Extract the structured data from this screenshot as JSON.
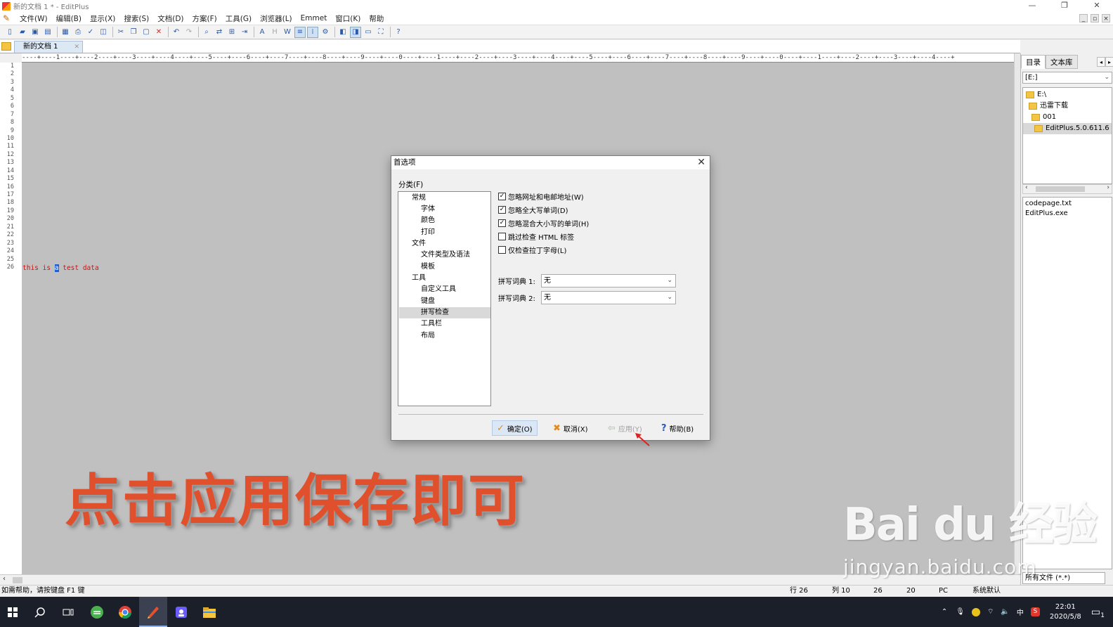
{
  "window": {
    "title": "新的文档 1 * - EditPlus",
    "controls": {
      "minimize": "—",
      "restore": "❐",
      "close": "✕"
    }
  },
  "menu": {
    "items": [
      "文件(W)",
      "编辑(B)",
      "显示(X)",
      "搜索(S)",
      "文档(D)",
      "方案(F)",
      "工具(G)",
      "浏览器(L)",
      "Emmet",
      "窗口(K)",
      "帮助"
    ],
    "mdi_controls": [
      "_",
      "▫",
      "×"
    ]
  },
  "tabs": {
    "document_tab": "新的文档 1"
  },
  "ruler": {
    "text": "----+----1----+----2----+----3----+----4----+----5----+----6----+----7----+----8----+----9----+----0----+----1----+----2----+----3----+----4----+----5----+----6----+----7----+----8----+----9----+----0----+----1----+----2----+----3----+----4----+"
  },
  "editor": {
    "line_numbers": [
      "1",
      "2",
      "3",
      "4",
      "5",
      "6",
      "7",
      "8",
      "9",
      "10",
      "11",
      "12",
      "13",
      "14",
      "15",
      "16",
      "17",
      "18",
      "19",
      "20",
      "21",
      "22",
      "23",
      "24",
      "25",
      "26"
    ],
    "line26_before": "this is ",
    "line26_selected": "a",
    "line26_after": " test data"
  },
  "caption": {
    "text": "点击应用保存即可",
    "color": "#e1502c"
  },
  "watermark": {
    "main": "Bai du 经验",
    "url": "jingyan.baidu.com"
  },
  "statusbar": {
    "help": "如需帮助，请按键盘 F1 键",
    "line": "行 26",
    "col": "列 10",
    "val1": "26",
    "val2": "20",
    "mode": "PC",
    "encoding": "系统默认"
  },
  "sidepanel": {
    "tabs": [
      "目录",
      "文本库"
    ],
    "drive": "[E:]",
    "tree": [
      "E:\\",
      "迅雷下载",
      "001",
      "EditPlus.5.0.611.6"
    ],
    "files": [
      "codepage.txt",
      "EditPlus.exe"
    ],
    "filter": "所有文件 (*.*)"
  },
  "dialog": {
    "title": "首选项",
    "category_label": "分类(F)",
    "categories": [
      {
        "label": "常规",
        "level": 0
      },
      {
        "label": "字体",
        "level": 1
      },
      {
        "label": "颜色",
        "level": 1
      },
      {
        "label": "打印",
        "level": 1
      },
      {
        "label": "文件",
        "level": 0
      },
      {
        "label": "文件类型及语法",
        "level": 1
      },
      {
        "label": "模板",
        "level": 1
      },
      {
        "label": "工具",
        "level": 0
      },
      {
        "label": "自定义工具",
        "level": 1
      },
      {
        "label": "键盘",
        "level": 1
      },
      {
        "label": "拼写检查",
        "level": 1,
        "selected": true
      },
      {
        "label": "工具栏",
        "level": 1
      },
      {
        "label": "布局",
        "level": 1
      }
    ],
    "checkboxes": [
      {
        "label": "忽略网址和电邮地址(W)",
        "checked": true
      },
      {
        "label": "忽略全大写单词(D)",
        "checked": true
      },
      {
        "label": "忽略混合大小写的单词(H)",
        "checked": true
      },
      {
        "label": "跳过检查 HTML 标签",
        "checked": false
      },
      {
        "label": "仅检查拉丁字母(L)",
        "checked": false
      }
    ],
    "dict1_label": "拼写词典 1:",
    "dict1_value": "无",
    "dict2_label": "拼写词典 2:",
    "dict2_value": "无",
    "buttons": {
      "ok": "确定(O)",
      "cancel": "取消(X)",
      "apply": "应用(Y)",
      "help": "帮助(B)"
    }
  },
  "taskbar": {
    "time": "22:01",
    "date": "2020/5/8",
    "ime": "中",
    "notification_count": "1"
  }
}
